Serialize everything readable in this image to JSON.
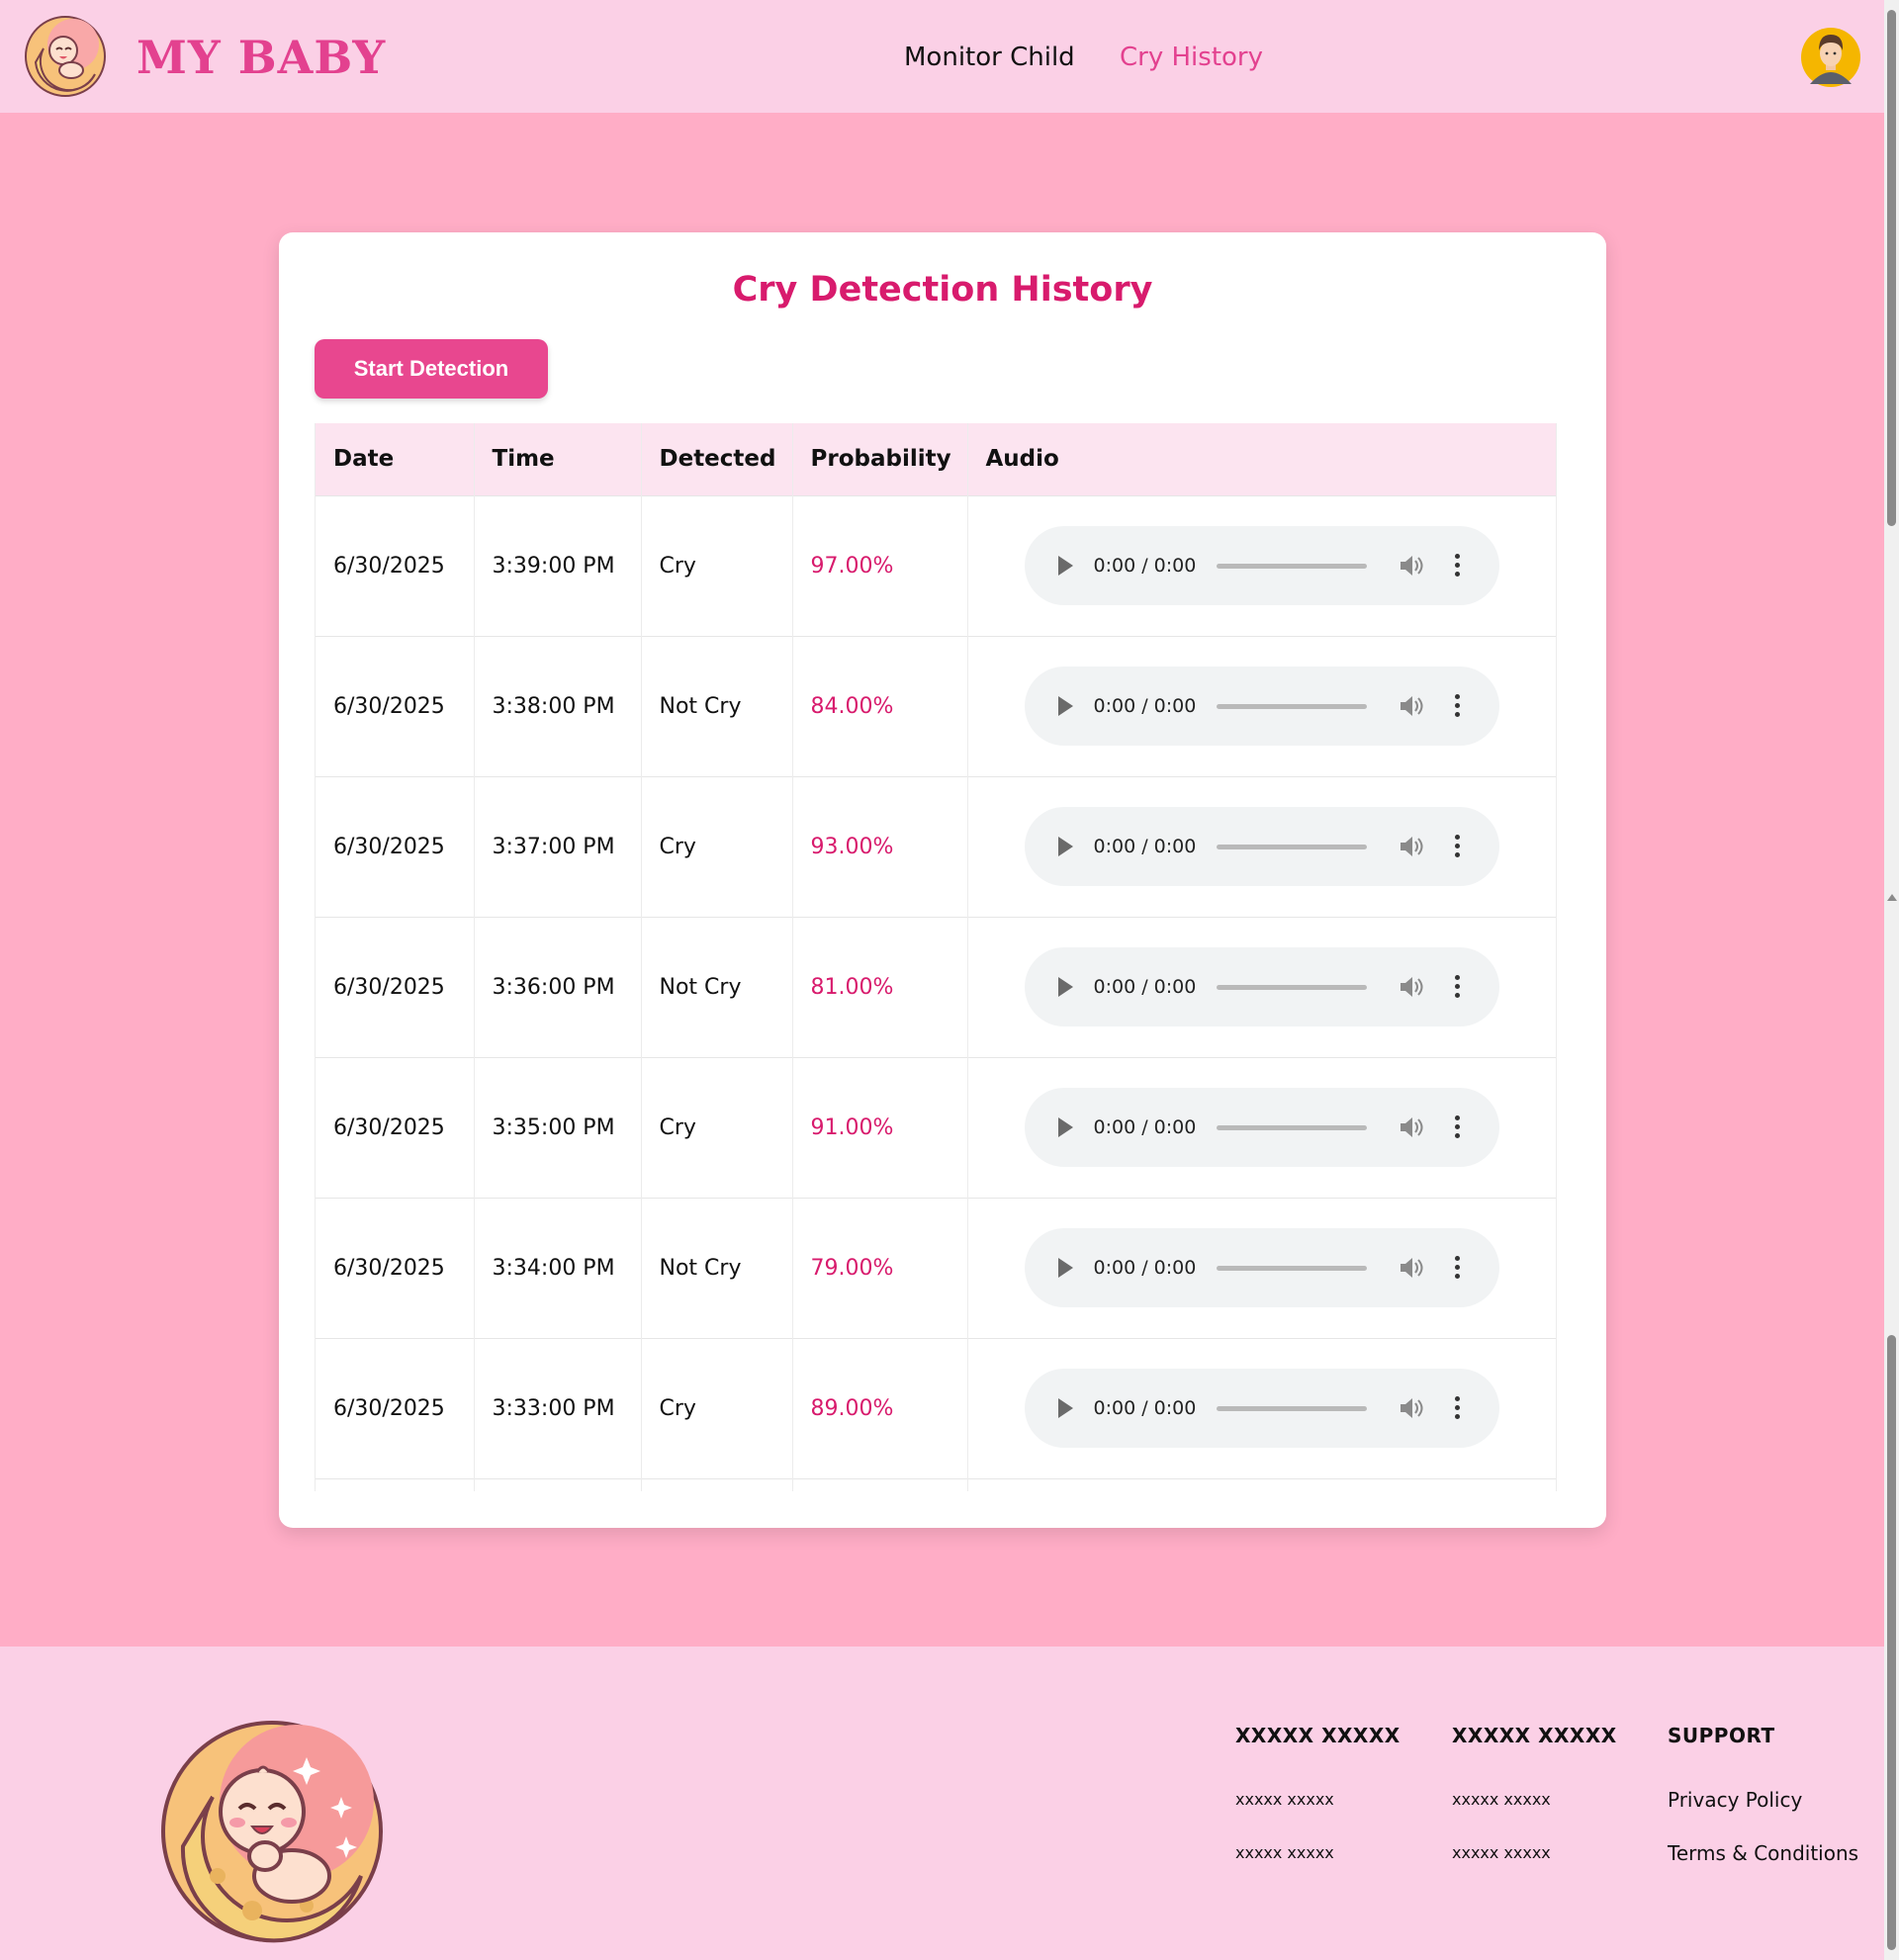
{
  "header": {
    "brand": "MY BABY",
    "nav": {
      "monitor": "Monitor Child",
      "history": "Cry History"
    },
    "active_color": "#e3418f"
  },
  "card": {
    "title": "Cry Detection History",
    "start_button": "Start Detection"
  },
  "table": {
    "columns": [
      "Date",
      "Time",
      "Detected",
      "Probability",
      "Audio"
    ],
    "rows": [
      {
        "date": "6/30/2025",
        "time": "3:39:00 PM",
        "detected": "Cry",
        "probability": "97.00%",
        "audio_time": "0:00 / 0:00"
      },
      {
        "date": "6/30/2025",
        "time": "3:38:00 PM",
        "detected": "Not Cry",
        "probability": "84.00%",
        "audio_time": "0:00 / 0:00"
      },
      {
        "date": "6/30/2025",
        "time": "3:37:00 PM",
        "detected": "Cry",
        "probability": "93.00%",
        "audio_time": "0:00 / 0:00"
      },
      {
        "date": "6/30/2025",
        "time": "3:36:00 PM",
        "detected": "Not Cry",
        "probability": "81.00%",
        "audio_time": "0:00 / 0:00"
      },
      {
        "date": "6/30/2025",
        "time": "3:35:00 PM",
        "detected": "Cry",
        "probability": "91.00%",
        "audio_time": "0:00 / 0:00"
      },
      {
        "date": "6/30/2025",
        "time": "3:34:00 PM",
        "detected": "Not Cry",
        "probability": "79.00%",
        "audio_time": "0:00 / 0:00"
      },
      {
        "date": "6/30/2025",
        "time": "3:33:00 PM",
        "detected": "Cry",
        "probability": "89.00%",
        "audio_time": "0:00 / 0:00"
      },
      {
        "date": "",
        "time": "",
        "detected": "",
        "probability": "",
        "audio_time": ""
      }
    ]
  },
  "footer": {
    "col1": {
      "heading": "XXXXX XXXXX",
      "links": [
        "xxxxx xxxxx",
        "xxxxx xxxxx"
      ]
    },
    "col2": {
      "heading": "XXXXX XXXXX",
      "links": [
        "xxxxx xxxxx",
        "xxxxx xxxxx"
      ]
    },
    "col3": {
      "heading": "SUPPORT",
      "links": [
        "Privacy Policy",
        "Terms & Conditions"
      ]
    }
  },
  "icons": {
    "logo": "baby-moon-icon",
    "avatar": "user-avatar-icon",
    "play": "play-icon",
    "volume": "volume-icon",
    "more": "more-vertical-icon"
  },
  "colors": {
    "page_bg": "#ffadc6",
    "header_bg": "#fbd0e6",
    "accent": "#e3418f",
    "probability": "#d81b6d",
    "table_header_bg": "#fce4f0"
  }
}
